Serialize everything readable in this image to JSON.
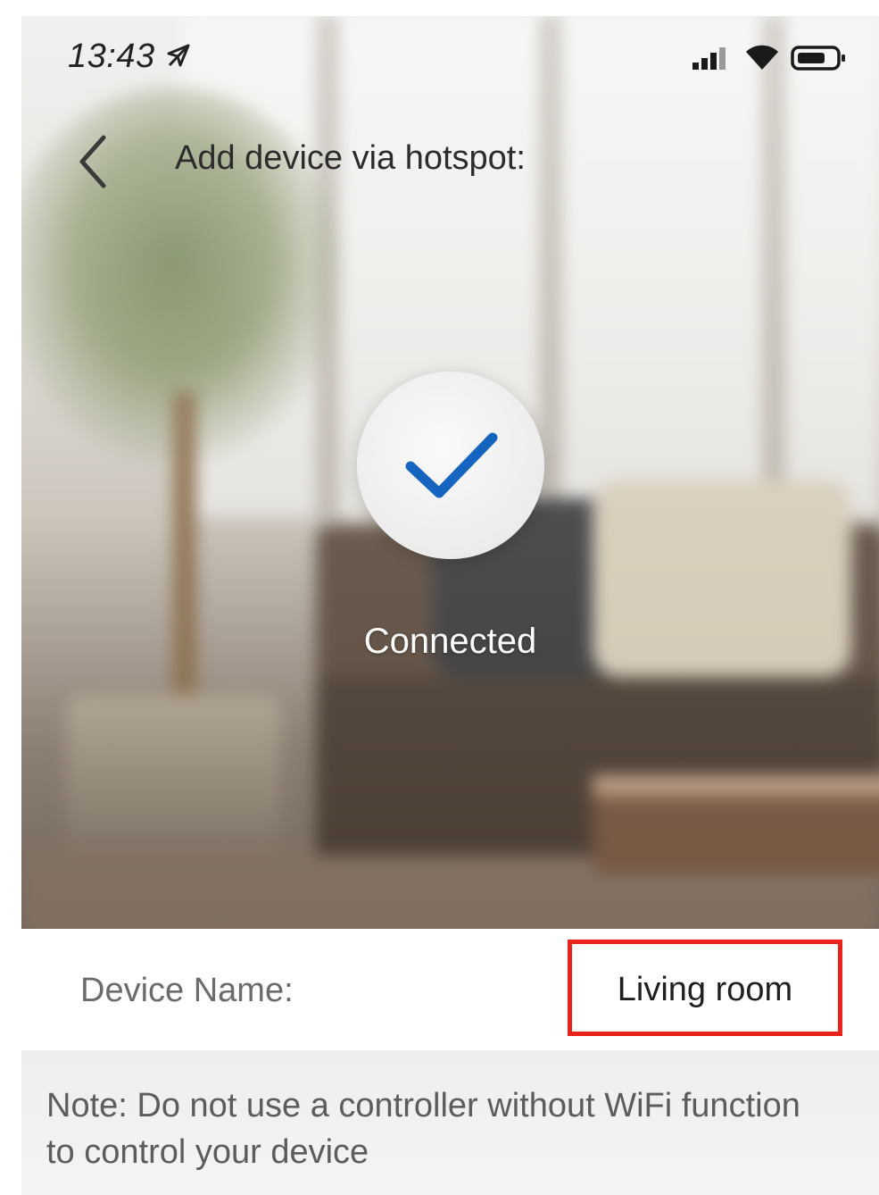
{
  "status_bar": {
    "time": "13:43",
    "icons": [
      "location-arrow-icon",
      "signal-icon",
      "wifi-icon",
      "battery-icon"
    ]
  },
  "header": {
    "title": "Add device via hotspot:",
    "back_icon": "chevron-left-icon"
  },
  "connection": {
    "status_label": "Connected",
    "icon": "checkmark-icon",
    "check_color": "#1565c0"
  },
  "device": {
    "name_label": "Device Name:",
    "name_value": "Living room",
    "highlight_color": "#e8231b"
  },
  "note": {
    "text": "Note: Do not use a controller without WiFi function to control your device"
  }
}
